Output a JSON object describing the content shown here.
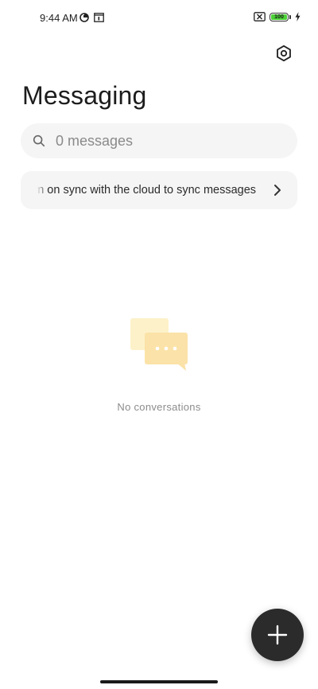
{
  "status_bar": {
    "time": "9:44 AM",
    "battery_level": "100",
    "battery_percent": 100,
    "icons": [
      "data-saver-icon",
      "calendar-icon",
      "no-sim-icon",
      "battery-icon",
      "charging-bolt-icon"
    ]
  },
  "header": {
    "title": "Messaging",
    "settings_icon": "settings-hexagon-icon"
  },
  "search": {
    "placeholder": "0 messages",
    "icon": "search-icon"
  },
  "sync_banner": {
    "text": "Turn on sync with the cloud to sync messages",
    "icon": "chevron-right-icon"
  },
  "empty_state": {
    "icon": "chat-bubbles-icon",
    "text": "No conversations"
  },
  "fab": {
    "icon": "plus-icon"
  },
  "colors": {
    "background": "#ffffff",
    "surface": "#f5f5f5",
    "fab": "#2b2b2b",
    "battery_fill": "#4cd137",
    "illustration_back": "#fdf1c9",
    "illustration_front": "#fbe2a8"
  }
}
